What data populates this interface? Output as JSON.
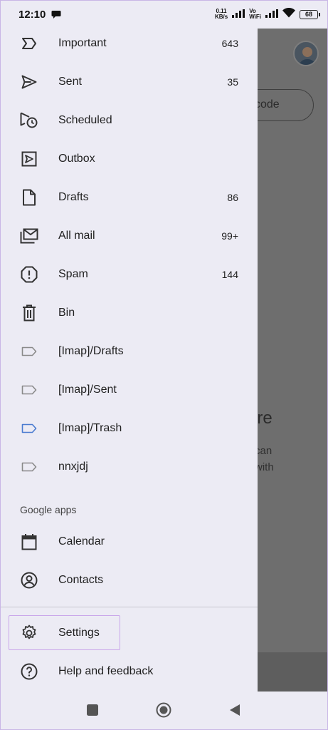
{
  "status_bar": {
    "time": "12:10",
    "speed_value": "0.11",
    "speed_unit": "KB/s",
    "vo": "Vo",
    "wifi_label": "WiFi",
    "battery": "68"
  },
  "background": {
    "button_text": "code",
    "heading_fragment": "are",
    "line1_fragment": "can",
    "line2_fragment": "with"
  },
  "drawer": {
    "items": [
      {
        "label": "Important",
        "count": "643",
        "icon": "important-icon"
      },
      {
        "label": "Sent",
        "count": "35",
        "icon": "send-icon"
      },
      {
        "label": "Scheduled",
        "count": "",
        "icon": "scheduled-icon"
      },
      {
        "label": "Outbox",
        "count": "",
        "icon": "outbox-icon"
      },
      {
        "label": "Drafts",
        "count": "86",
        "icon": "draft-icon"
      },
      {
        "label": "All mail",
        "count": "99+",
        "icon": "all-mail-icon"
      },
      {
        "label": "Spam",
        "count": "144",
        "icon": "spam-icon"
      },
      {
        "label": "Bin",
        "count": "",
        "icon": "bin-icon"
      },
      {
        "label": "[Imap]/Drafts",
        "count": "",
        "icon": "label-icon"
      },
      {
        "label": "[Imap]/Sent",
        "count": "",
        "icon": "label-icon"
      },
      {
        "label": "[Imap]/Trash",
        "count": "",
        "icon": "label-icon",
        "color": "#4a7bd0"
      },
      {
        "label": "nnxjdj",
        "count": "",
        "icon": "label-icon"
      }
    ],
    "google_apps_title": "Google apps",
    "apps": [
      {
        "label": "Calendar",
        "icon": "calendar-icon"
      },
      {
        "label": "Contacts",
        "icon": "contacts-icon"
      }
    ],
    "settings_label": "Settings",
    "help_label": "Help and feedback"
  },
  "colors": {
    "drawer_bg": "#ecebf4",
    "scrim": "#6e6e6e",
    "highlight": "#c9a6ea",
    "label_blue": "#4a7bd0"
  }
}
